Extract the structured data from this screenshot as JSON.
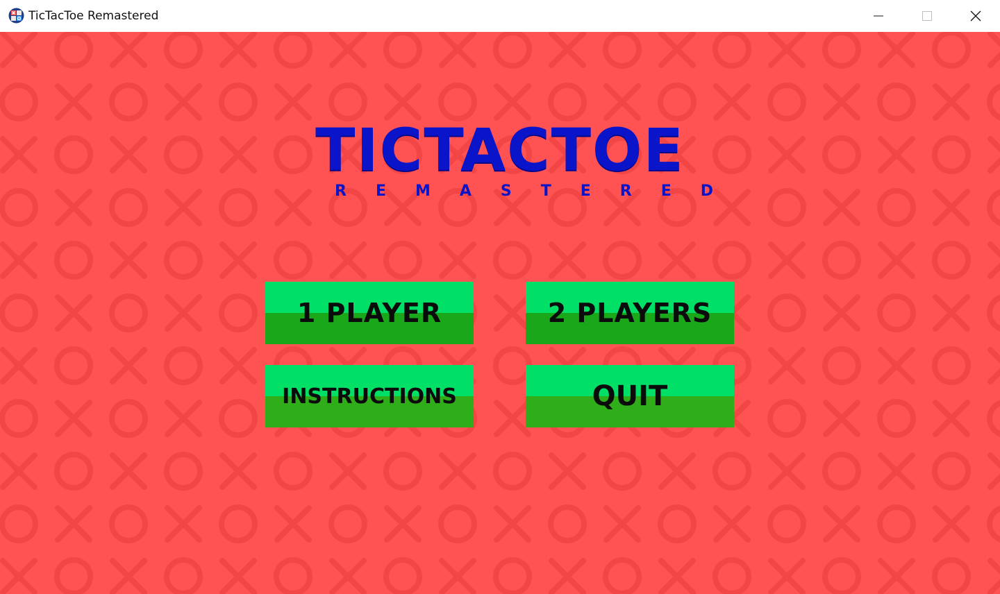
{
  "window": {
    "title": "TicTacToe Remastered",
    "icon": "app-icon"
  },
  "window_controls": {
    "minimize_icon": "minimize-icon",
    "maximize_icon": "maximize-icon",
    "close_icon": "close-icon"
  },
  "game": {
    "background_color": "#ff5252",
    "pattern_color": "#f24646",
    "logo": {
      "title": "TICTACTOE",
      "subtitle": "REMASTERED",
      "color": "#0a14c8"
    },
    "menu": {
      "one_player": "1 PLAYER",
      "two_players": "2 PLAYERS",
      "instructions": "INSTRUCTIONS",
      "quit": "QUIT"
    },
    "button_colors": {
      "top": "#00e066",
      "bottom": "#1aa81a"
    }
  }
}
